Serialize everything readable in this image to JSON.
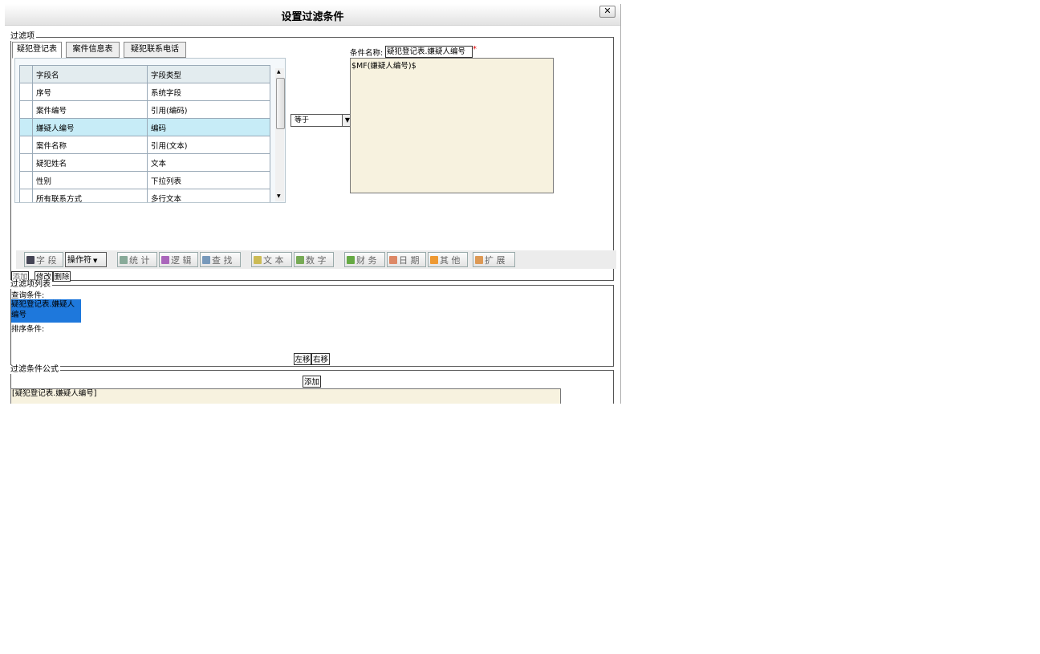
{
  "dialog": {
    "title": "设置过滤条件",
    "close_label": "✕"
  },
  "filter_items": {
    "legend": "过滤项",
    "tabs": [
      {
        "label": "疑犯登记表"
      },
      {
        "label": "案件信息表"
      },
      {
        "label": "疑犯联系电话"
      }
    ],
    "grid": {
      "headers": [
        "字段名",
        "字段类型"
      ],
      "rows": [
        [
          "序号",
          "系统字段"
        ],
        [
          "案件编号",
          "引用(编码)"
        ],
        [
          "嫌疑人编号",
          "编码"
        ],
        [
          "案件名称",
          "引用(文本)"
        ],
        [
          "疑犯姓名",
          "文本"
        ],
        [
          "性别",
          "下拉列表"
        ],
        [
          "所有联系方式",
          "多行文本"
        ]
      ],
      "selected_row": 2
    },
    "operator": {
      "value": "等于",
      "arrow": "▼"
    },
    "condition_name_label": "条件名称:",
    "condition_name_value": "疑犯登记表.嫌疑人编号",
    "required_mark": "*",
    "expression": "$MF(嫌疑人编号)$",
    "scroll_up": "▲",
    "scroll_down": "▼",
    "toolbar": {
      "field": "字 段",
      "operator": "操作符",
      "operator_arrow": "▼",
      "statistics": "统 计",
      "logic": "逻 辑",
      "lookup": "查 找",
      "text": "文 本",
      "number": "数 字",
      "finance": "财 务",
      "date": "日 期",
      "other": "其 他",
      "extend": "扩 展"
    },
    "buttons": {
      "add": "添加",
      "modify": "修改",
      "delete": "删除"
    }
  },
  "filter_list": {
    "legend": "过滤项列表",
    "query_label": "查询条件:",
    "query_item_line1": "疑犯登记表.嫌疑人",
    "query_item_line2": "编号",
    "sort_label": "排序条件:",
    "left_label": "左移",
    "right_label": "右移"
  },
  "formula": {
    "legend": "过滤条件公式",
    "add_label": "添加",
    "value": "[疑犯登记表.嫌疑人编号]"
  }
}
